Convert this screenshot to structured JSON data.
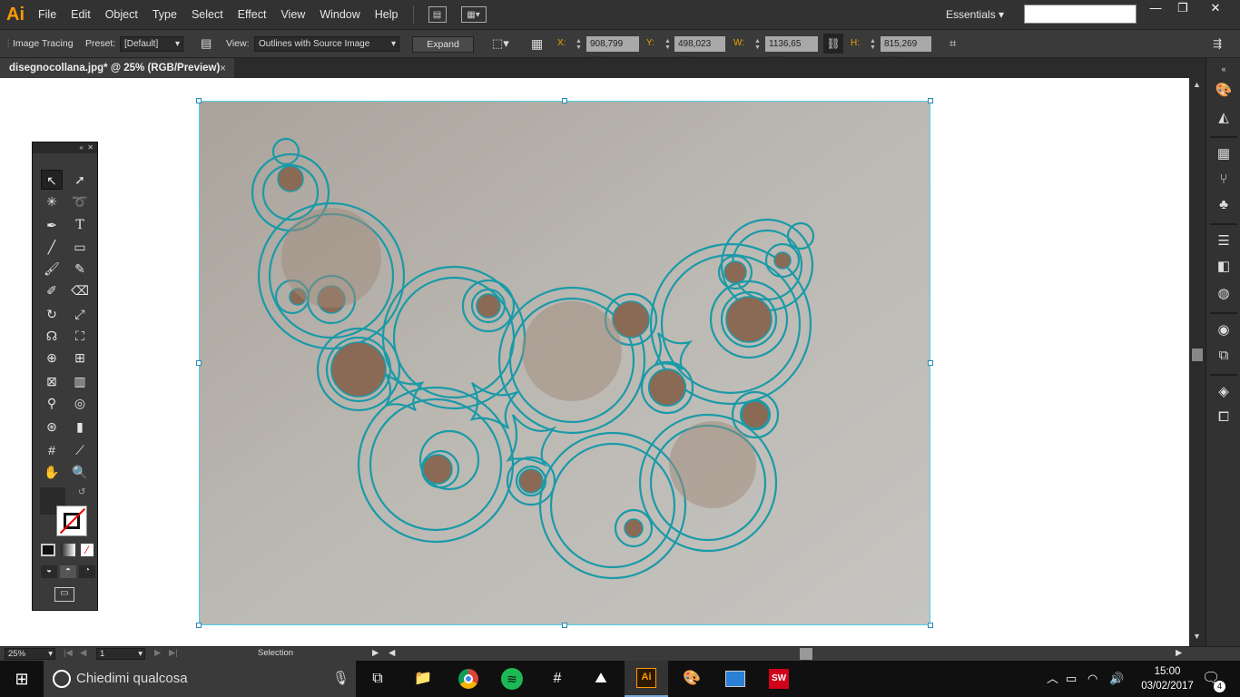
{
  "app": {
    "logo": "Ai",
    "menu": [
      "File",
      "Edit",
      "Object",
      "Type",
      "Select",
      "Effect",
      "View",
      "Window",
      "Help"
    ],
    "workspace": "Essentials",
    "search_placeholder": ""
  },
  "control_bar": {
    "panel_label": "Image Tracing",
    "preset_label": "Preset:",
    "preset_value": "[Default]",
    "view_label": "View:",
    "view_value": "Outlines with Source Image",
    "expand_label": "Expand",
    "x_label": "X:",
    "x_value": "908,799 mm",
    "y_label": "Y:",
    "y_value": "498,023 mm",
    "w_label": "W:",
    "w_value": "1136,65 mm",
    "h_label": "H:",
    "h_value": "815,269 mm"
  },
  "document": {
    "tab_title": "disegnocollana.jpg* @ 25% (RGB/Preview)",
    "close_glyph": "×"
  },
  "status_bar": {
    "zoom": "25%",
    "artboard": "1",
    "tool_status": "Selection"
  },
  "taskbar": {
    "search_text": "Chiedimi qualcosa",
    "time": "15:00",
    "date": "03/02/2017",
    "notification_count": "4",
    "apps": [
      "task-view",
      "file-explorer",
      "chrome",
      "spotify",
      "slack",
      "photos",
      "illustrator",
      "paint",
      "remote-desktop",
      "solidworks"
    ],
    "active_app": "illustrator"
  },
  "colors": {
    "accent_ai": "#ff9a00",
    "trace_outline": "#1aa8b8",
    "selection_bounds": "#4fd0e6",
    "fill_brown": "#8a6a55"
  }
}
